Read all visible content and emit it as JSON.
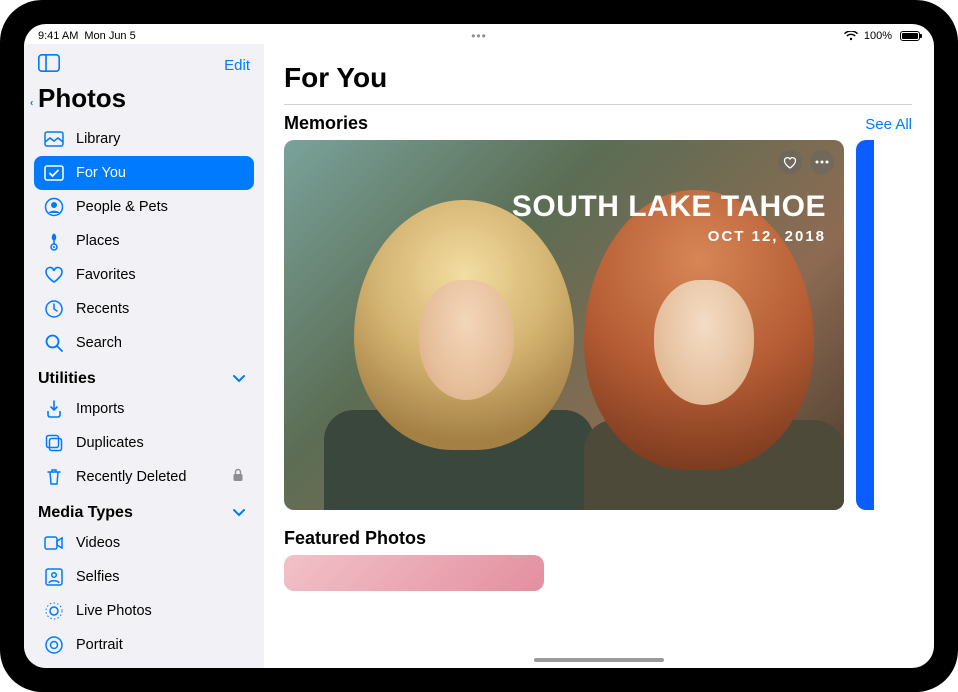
{
  "status": {
    "time": "9:41 AM",
    "date": "Mon Jun 5",
    "battery_pct": "100%"
  },
  "sidebar": {
    "edit": "Edit",
    "title": "Photos",
    "nav": [
      {
        "label": "Library"
      },
      {
        "label": "For You"
      },
      {
        "label": "People & Pets"
      },
      {
        "label": "Places"
      },
      {
        "label": "Favorites"
      },
      {
        "label": "Recents"
      },
      {
        "label": "Search"
      }
    ],
    "section_utilities": "Utilities",
    "utilities": [
      {
        "label": "Imports"
      },
      {
        "label": "Duplicates"
      },
      {
        "label": "Recently Deleted"
      }
    ],
    "section_media": "Media Types",
    "media": [
      {
        "label": "Videos"
      },
      {
        "label": "Selfies"
      },
      {
        "label": "Live Photos"
      },
      {
        "label": "Portrait"
      }
    ]
  },
  "main": {
    "title": "For You",
    "memories_header": "Memories",
    "see_all": "See All",
    "memory": {
      "title": "SOUTH LAKE TAHOE",
      "date": "OCT 12, 2018"
    },
    "featured_header": "Featured Photos"
  }
}
